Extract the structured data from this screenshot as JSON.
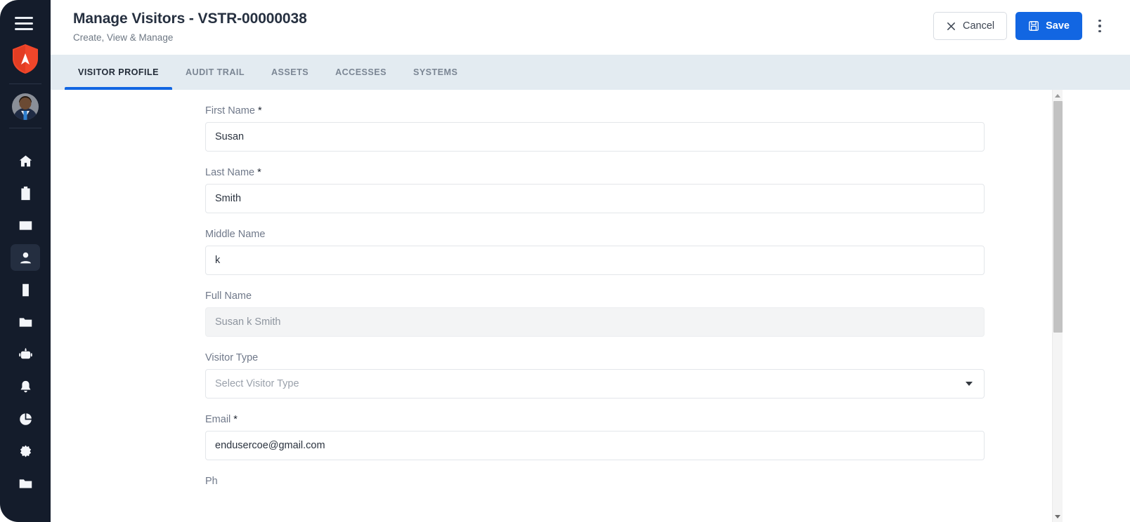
{
  "sidebar": {
    "menu_toggle": "menu-toggle",
    "brand": "shield-logo",
    "avatar": "user-avatar",
    "items": [
      {
        "icon": "home-icon",
        "name": "home",
        "active": false
      },
      {
        "icon": "badge-icon",
        "name": "badge",
        "active": false
      },
      {
        "icon": "id-card-icon",
        "name": "id-card",
        "active": false
      },
      {
        "icon": "person-icon",
        "name": "visitors",
        "active": true
      },
      {
        "icon": "mobile-icon",
        "name": "mobile",
        "active": false
      },
      {
        "icon": "folder-icon",
        "name": "folder",
        "active": false
      },
      {
        "icon": "robot-icon",
        "name": "robot",
        "active": false
      },
      {
        "icon": "bell-icon",
        "name": "notifications",
        "active": false
      },
      {
        "icon": "pie-chart-icon",
        "name": "reports",
        "active": false
      },
      {
        "icon": "gear-icon",
        "name": "settings",
        "active": false
      },
      {
        "icon": "folder-icon",
        "name": "documents",
        "active": false
      }
    ]
  },
  "header": {
    "title": "Manage Visitors - VSTR-00000038",
    "subtitle": "Create, View & Manage",
    "cancel_label": "Cancel",
    "save_label": "Save",
    "more_menu": "more-options"
  },
  "tabs": [
    {
      "label": "VISITOR PROFILE",
      "active": true
    },
    {
      "label": "AUDIT TRAIL",
      "active": false
    },
    {
      "label": "ASSETS",
      "active": false
    },
    {
      "label": "ACCESSES",
      "active": false
    },
    {
      "label": "SYSTEMS",
      "active": false
    }
  ],
  "form": {
    "first_name": {
      "label": "First Name",
      "required": "*",
      "value": "Susan"
    },
    "last_name": {
      "label": "Last Name",
      "required": "*",
      "value": "Smith"
    },
    "middle_name": {
      "label": "Middle Name",
      "value": "k"
    },
    "full_name": {
      "label": "Full Name",
      "value": "Susan k Smith"
    },
    "visitor_type": {
      "label": "Visitor Type",
      "placeholder": "Select Visitor Type"
    },
    "email": {
      "label": "Email",
      "required": "*",
      "value": "endusercoe@gmail.com"
    },
    "phone": {
      "label": "Ph"
    }
  },
  "colors": {
    "sidebar_bg": "#141c2b",
    "brand_orange": "#f0462a",
    "primary_blue": "#1266e2",
    "tabbar_bg": "#e3ebf1"
  }
}
